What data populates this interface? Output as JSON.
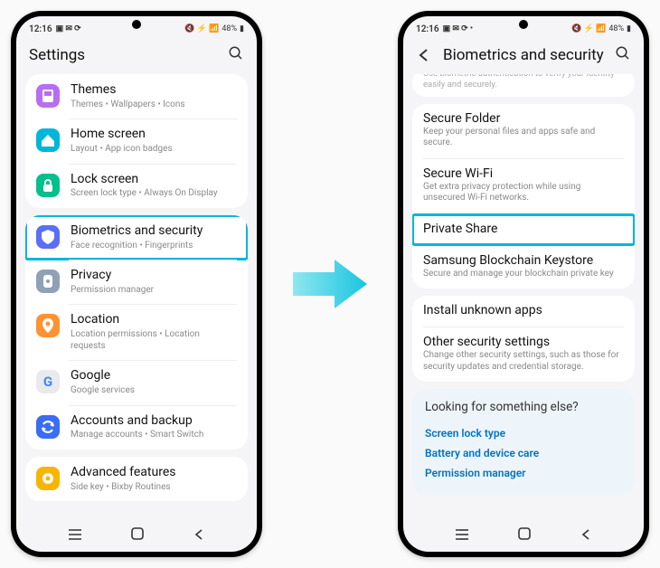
{
  "status": {
    "time": "12:16",
    "battery_text": "48%"
  },
  "left": {
    "title": "Settings",
    "items": [
      {
        "icon": "themes",
        "color": "#b86ef0",
        "title": "Themes",
        "sub": "Themes • Wallpapers • Icons"
      },
      {
        "icon": "home",
        "color": "#00b6d9",
        "title": "Home screen",
        "sub": "Layout • App icon badges"
      },
      {
        "icon": "lock",
        "color": "#00c08b",
        "title": "Lock screen",
        "sub": "Screen lock type • Always On Display"
      },
      {
        "icon": "shield",
        "color": "#5b6ef5",
        "title": "Biometrics and security",
        "sub": "Face recognition • Fingerprints",
        "highlight": true
      },
      {
        "icon": "privacy",
        "color": "#8fa0b8",
        "title": "Privacy",
        "sub": "Permission manager"
      },
      {
        "icon": "location",
        "color": "#ff9233",
        "title": "Location",
        "sub": "Location permissions • Location requests"
      },
      {
        "icon": "google",
        "color": "#e8eaed",
        "title": "Google",
        "sub": "Google services"
      },
      {
        "icon": "sync",
        "color": "#3a6cf4",
        "title": "Accounts and backup",
        "sub": "Manage accounts • Smart Switch"
      },
      {
        "icon": "gear",
        "color": "#f7b500",
        "title": "Advanced features",
        "sub": "Side key • Bixby Routines"
      }
    ]
  },
  "right": {
    "title": "Biometrics and security",
    "partial": "Use biometric authentication to verify your identity easily and securely.",
    "group1": [
      {
        "title": "Secure Folder",
        "sub": "Keep your personal files and apps safe and secure."
      },
      {
        "title": "Secure Wi-Fi",
        "sub": "Get extra privacy protection while using unsecured Wi-Fi networks."
      },
      {
        "title": "Private Share",
        "sub": "",
        "highlight": true
      },
      {
        "title": "Samsung Blockchain Keystore",
        "sub": "Secure and manage your blockchain private key"
      }
    ],
    "group2": [
      {
        "title": "Install unknown apps",
        "sub": ""
      },
      {
        "title": "Other security settings",
        "sub": "Change other security settings, such as those for security updates and credential storage."
      }
    ],
    "looking": {
      "title": "Looking for something else?",
      "links": [
        "Screen lock type",
        "Battery and device care",
        "Permission manager"
      ]
    }
  }
}
